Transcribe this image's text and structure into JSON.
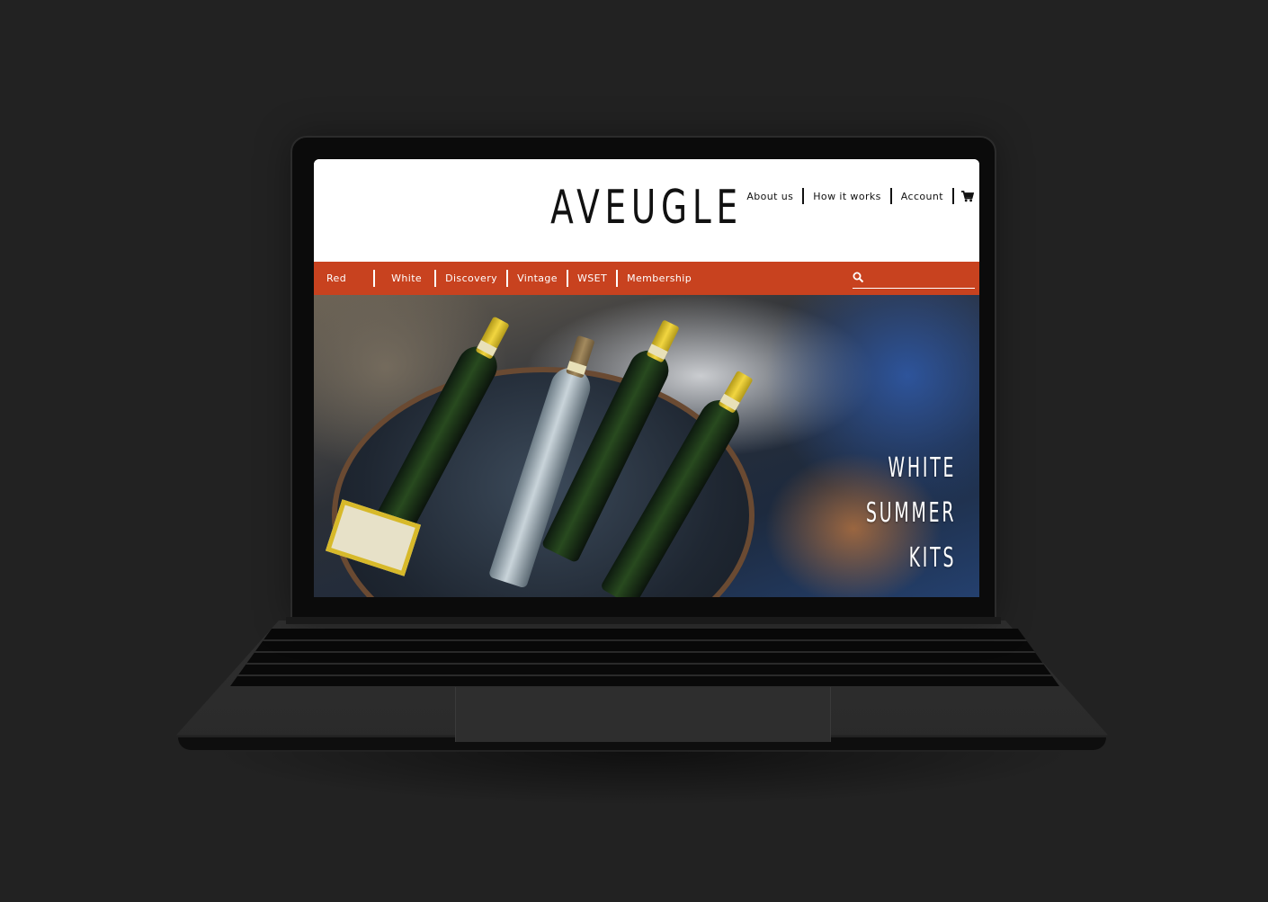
{
  "site": {
    "logo": "AVEUGLE",
    "top_nav": [
      "About us",
      "How it works",
      "Account"
    ],
    "cart_icon": "cart-icon",
    "categories": [
      "Red",
      "White",
      "Discovery",
      "Vintage",
      "WSET",
      "Membership"
    ],
    "search": {
      "icon": "search-icon",
      "placeholder": "",
      "value": ""
    },
    "hero": {
      "lines": [
        "WHITE",
        "SUMMER",
        "KITS"
      ]
    }
  },
  "colors": {
    "background": "#222222",
    "category_bar": "#c8421f",
    "header": "#ffffff",
    "text_dark": "#111111",
    "text_light": "#ffffff"
  }
}
